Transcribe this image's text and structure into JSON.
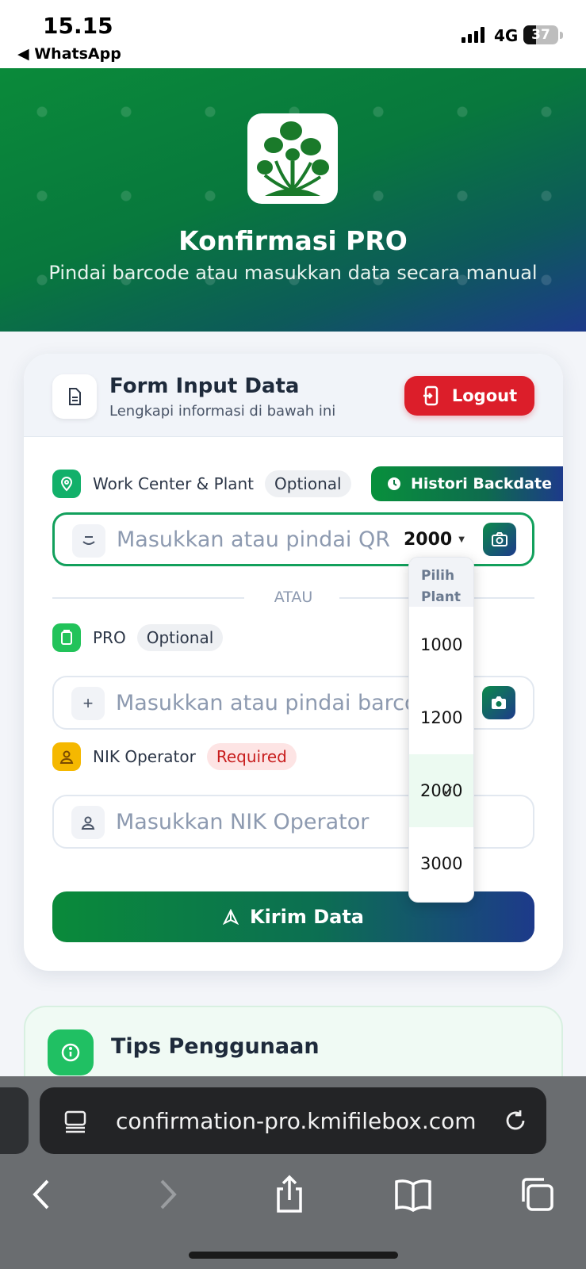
{
  "status": {
    "time": "15.15",
    "back_app": "◀ WhatsApp",
    "network": "4G",
    "battery": "37"
  },
  "hero": {
    "title": "Konfirmasi PRO",
    "subtitle": "Pindai barcode atau masukkan data secara manual"
  },
  "form": {
    "title": "Form Input Data",
    "subtitle": "Lengkapi informasi di bawah ini",
    "logout_label": "Logout",
    "work_center": {
      "label": "Work Center & Plant",
      "badge": "Optional",
      "histori_label": "Histori Backdate",
      "placeholder": "Masukkan atau pindai QR Work Center",
      "plant_value": "2000"
    },
    "divider_text": "ATAU",
    "pro": {
      "label": "PRO",
      "badge": "Optional",
      "placeholder": "Masukkan atau pindai barcode PRO"
    },
    "nik": {
      "label": "NIK Operator",
      "badge": "Required",
      "placeholder": "Masukkan NIK Operator"
    },
    "submit_label": "Kirim Data"
  },
  "plant_dropdown": {
    "header": "Pilih Plant",
    "options": [
      "1000",
      "1200",
      "2000",
      "3000"
    ],
    "selected": "2000"
  },
  "tips": {
    "title": "Tips Penggunaan"
  },
  "browser": {
    "url": "confirmation-pro.kmifilebox.com"
  },
  "colors": {
    "brand_green": "#0a8a3a",
    "brand_navy": "#1d3a8a",
    "logout_red": "#dc1e2a",
    "required_red": "#c81e1e"
  },
  "icons": [
    "document-icon",
    "logout-icon",
    "location-pin-icon",
    "clock-icon",
    "qr-icon",
    "camera-icon",
    "clipboard-icon",
    "plus-icon",
    "user-icon",
    "send-icon",
    "info-icon",
    "reader-icon",
    "reload-icon",
    "back-icon",
    "forward-icon",
    "share-icon",
    "bookmarks-icon",
    "tabs-icon"
  ]
}
